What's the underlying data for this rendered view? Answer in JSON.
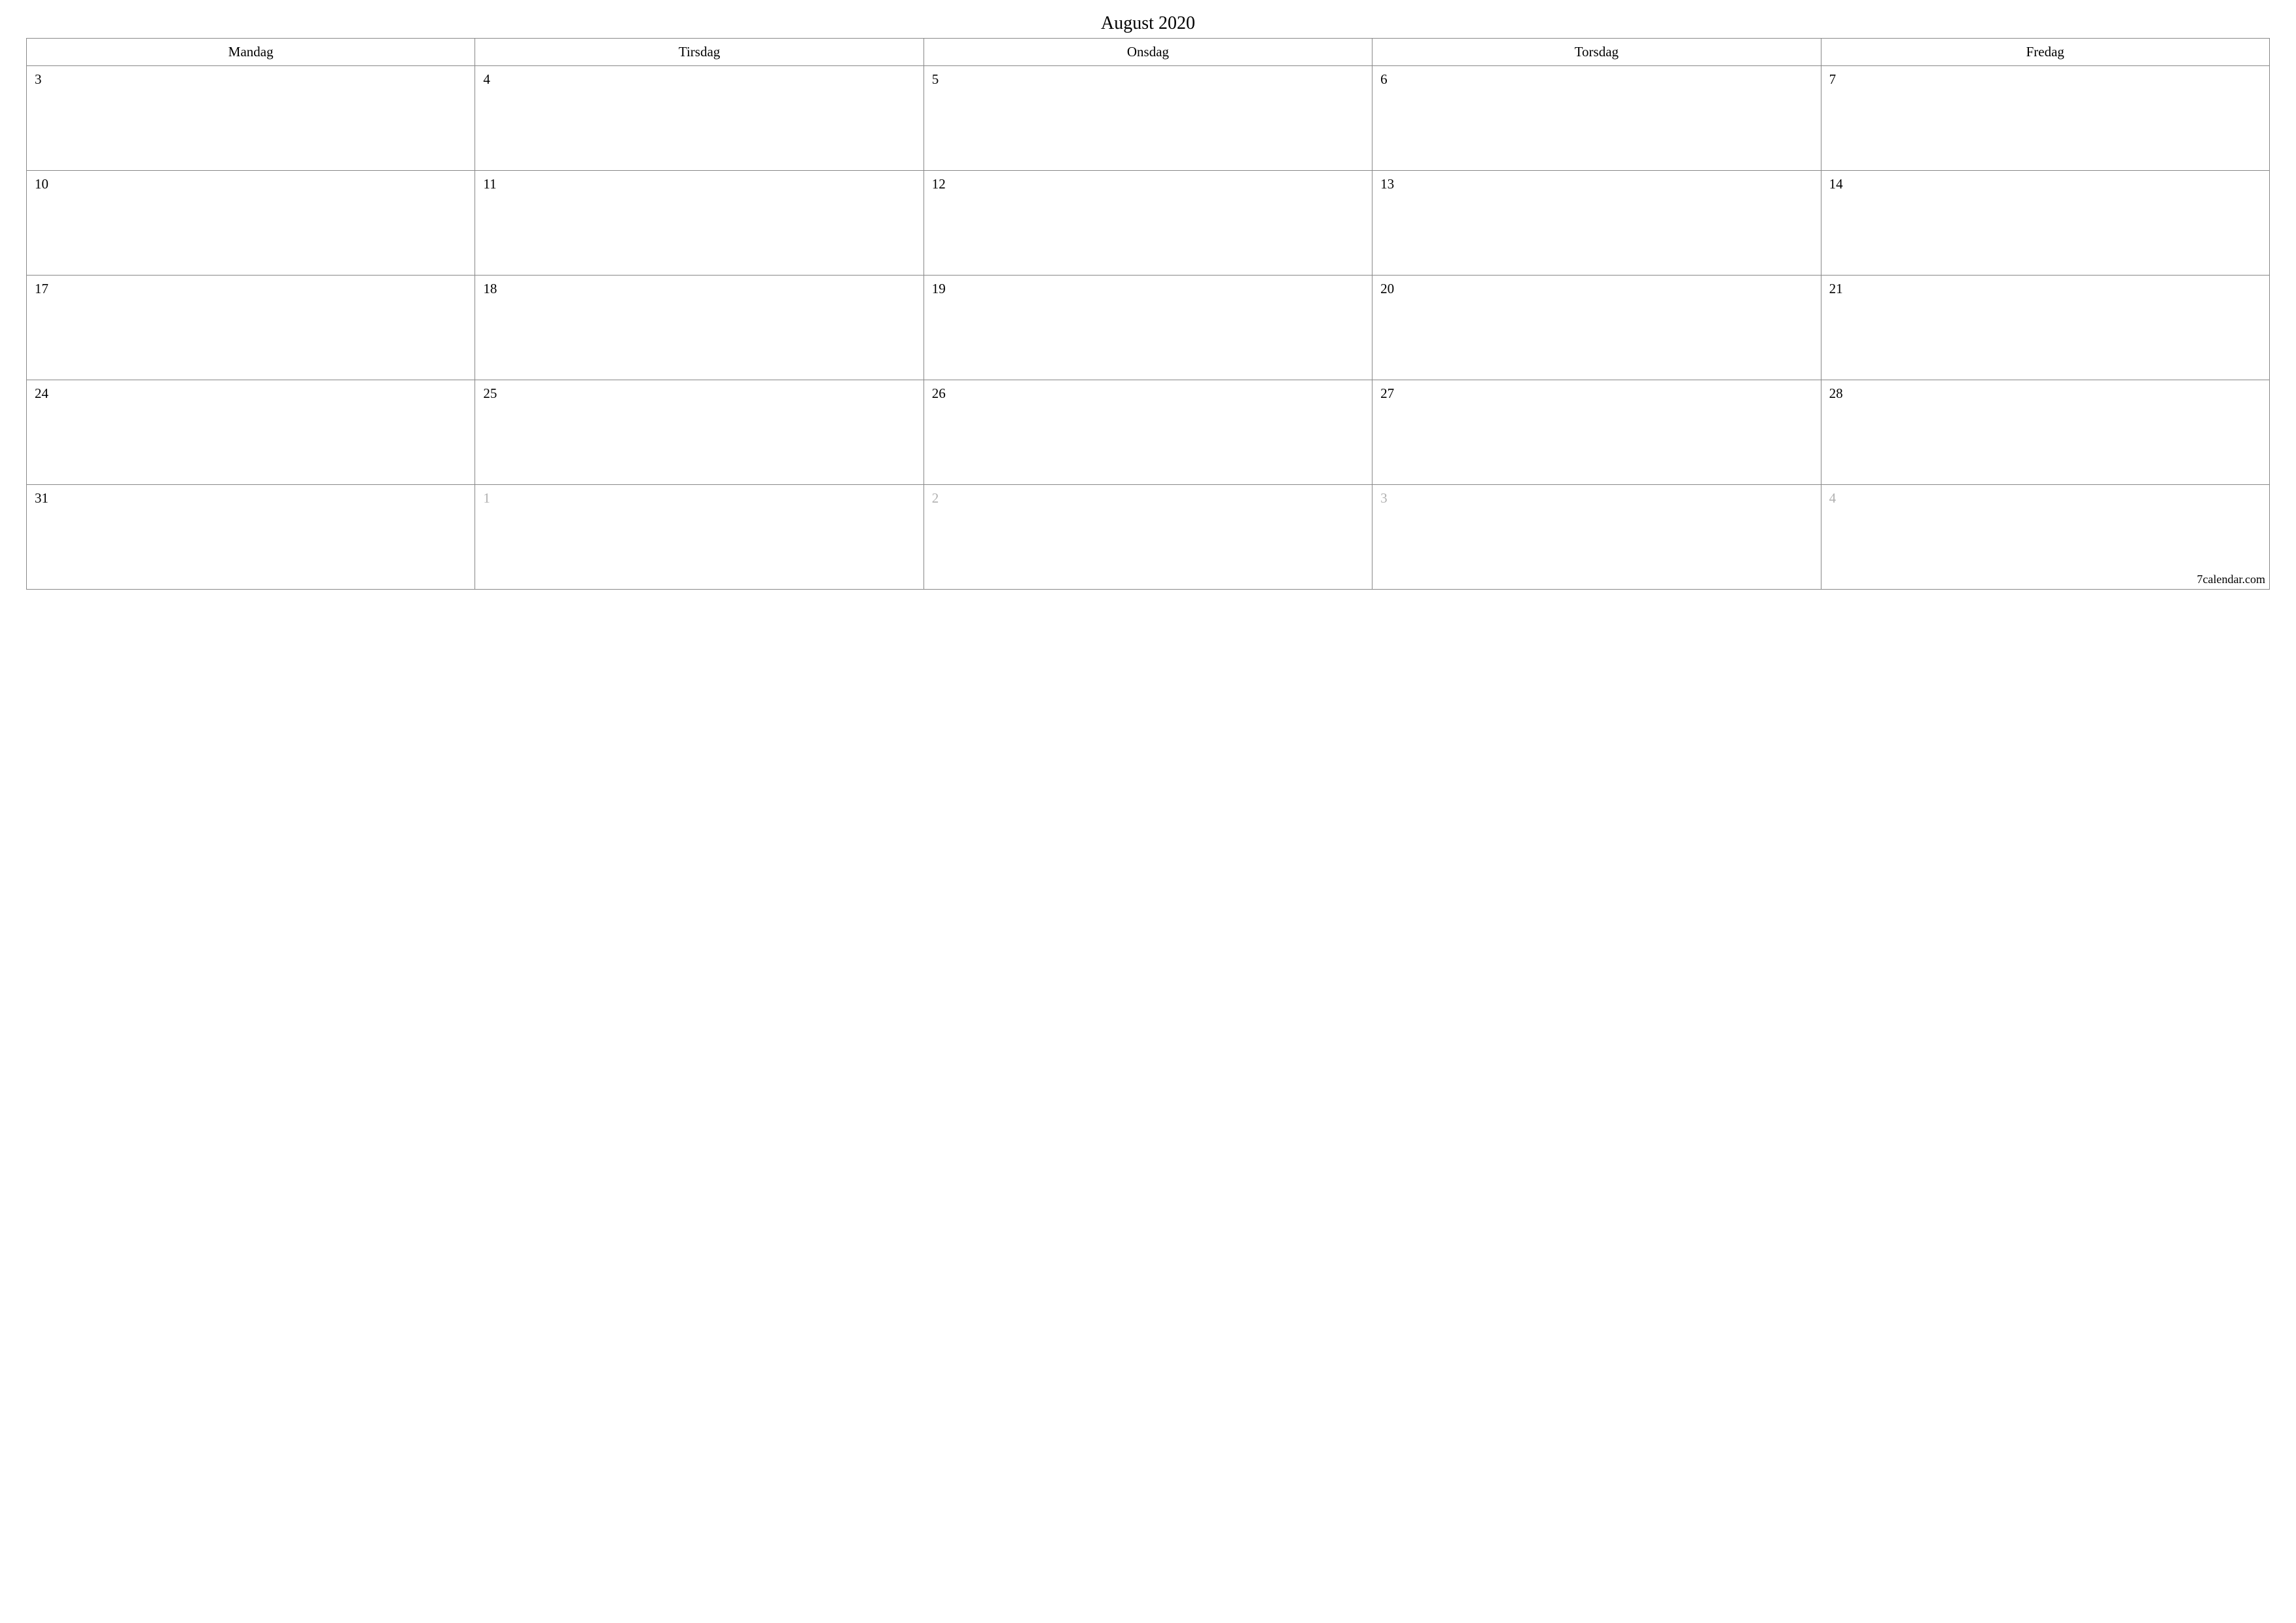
{
  "title": "August 2020",
  "headers": [
    "Mandag",
    "Tirsdag",
    "Onsdag",
    "Torsdag",
    "Fredag"
  ],
  "weeks": [
    [
      {
        "n": "3",
        "muted": false
      },
      {
        "n": "4",
        "muted": false
      },
      {
        "n": "5",
        "muted": false
      },
      {
        "n": "6",
        "muted": false
      },
      {
        "n": "7",
        "muted": false
      }
    ],
    [
      {
        "n": "10",
        "muted": false
      },
      {
        "n": "11",
        "muted": false
      },
      {
        "n": "12",
        "muted": false
      },
      {
        "n": "13",
        "muted": false
      },
      {
        "n": "14",
        "muted": false
      }
    ],
    [
      {
        "n": "17",
        "muted": false
      },
      {
        "n": "18",
        "muted": false
      },
      {
        "n": "19",
        "muted": false
      },
      {
        "n": "20",
        "muted": false
      },
      {
        "n": "21",
        "muted": false
      }
    ],
    [
      {
        "n": "24",
        "muted": false
      },
      {
        "n": "25",
        "muted": false
      },
      {
        "n": "26",
        "muted": false
      },
      {
        "n": "27",
        "muted": false
      },
      {
        "n": "28",
        "muted": false
      }
    ],
    [
      {
        "n": "31",
        "muted": false
      },
      {
        "n": "1",
        "muted": true
      },
      {
        "n": "2",
        "muted": true
      },
      {
        "n": "3",
        "muted": true
      },
      {
        "n": "4",
        "muted": true
      }
    ]
  ],
  "footer": "7calendar.com"
}
